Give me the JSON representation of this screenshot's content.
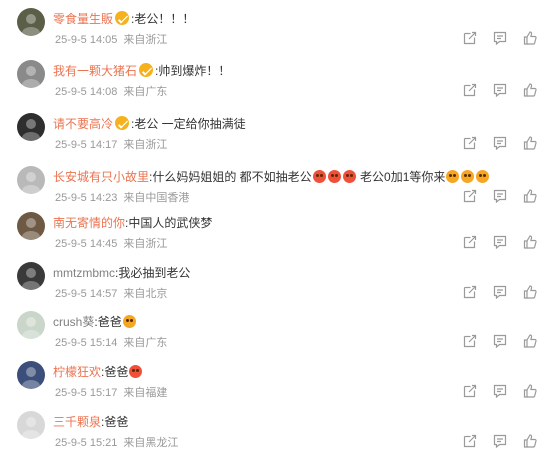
{
  "comments": [
    {
      "user": "零食量生販",
      "text": ":老公！！！",
      "emojis": [],
      "date": "25-9-5 14:05",
      "location": "来自浙江",
      "vip": true,
      "avatar_color": "#5b5f48",
      "name_color": "#eb7350"
    },
    {
      "user": "我有一颗大猪石",
      "text": ":帅到爆炸！！",
      "emojis": [],
      "date": "25-9-5 14:08",
      "location": "来自广东",
      "vip": true,
      "avatar_color": "#8a8a8a",
      "name_color": "#eb7350"
    },
    {
      "user": "请不要高冷",
      "text": ":老公 一定给你抽满徒",
      "emojis": [],
      "date": "25-9-5 14:17",
      "location": "来自浙江",
      "vip": true,
      "avatar_color": "#2e2e2e",
      "name_color": "#eb7350"
    },
    {
      "user": "长安城有只小故里",
      "text": ":什么妈妈姐姐的 都不如抽老公",
      "text2": " 老公0加1等你来",
      "emojis": [
        "emo-red",
        "emo-red",
        "emo-red"
      ],
      "emojis2": [
        "emo",
        "emo",
        "emo"
      ],
      "date": "25-9-5 14:23",
      "location": "来自中国香港",
      "vip": false,
      "avatar_color": "#b9b9b9",
      "name_color": "#eb7350"
    },
    {
      "user": "南无寄情的你",
      "text": ":中国人的武侠梦",
      "emojis": [],
      "date": "25-9-5 14:45",
      "location": "来自浙江",
      "vip": false,
      "avatar_color": "#6e5a44",
      "name_color": "#eb7350"
    },
    {
      "user": "mmtzmbmc",
      "text": ":我必抽到老公",
      "emojis": [],
      "date": "25-9-5 14:57",
      "location": "来自北京",
      "vip": false,
      "avatar_color": "#3a3a3a",
      "name_color": "#808080"
    },
    {
      "user": "crush葵",
      "text": ":爸爸",
      "emojis": [
        "emo"
      ],
      "date": "25-9-5 15:14",
      "location": "来自广东",
      "vip": false,
      "avatar_color": "#c9d6c9",
      "name_color": "#808080"
    },
    {
      "user": "柠檬狂欢",
      "text": ":爸爸",
      "emojis": [
        "emo-red"
      ],
      "date": "25-9-5 15:17",
      "location": "来自福建",
      "vip": false,
      "avatar_color": "#3c4f7a",
      "name_color": "#eb7350"
    },
    {
      "user": "三千颗泉",
      "text": ":爸爸",
      "emojis": [],
      "date": "25-9-5 15:21",
      "location": "来自黑龙江",
      "vip": false,
      "avatar_color": "#d8d8d8",
      "name_color": "#eb7350"
    }
  ],
  "icons": [
    "share-icon",
    "comment-icon",
    "like-icon"
  ]
}
